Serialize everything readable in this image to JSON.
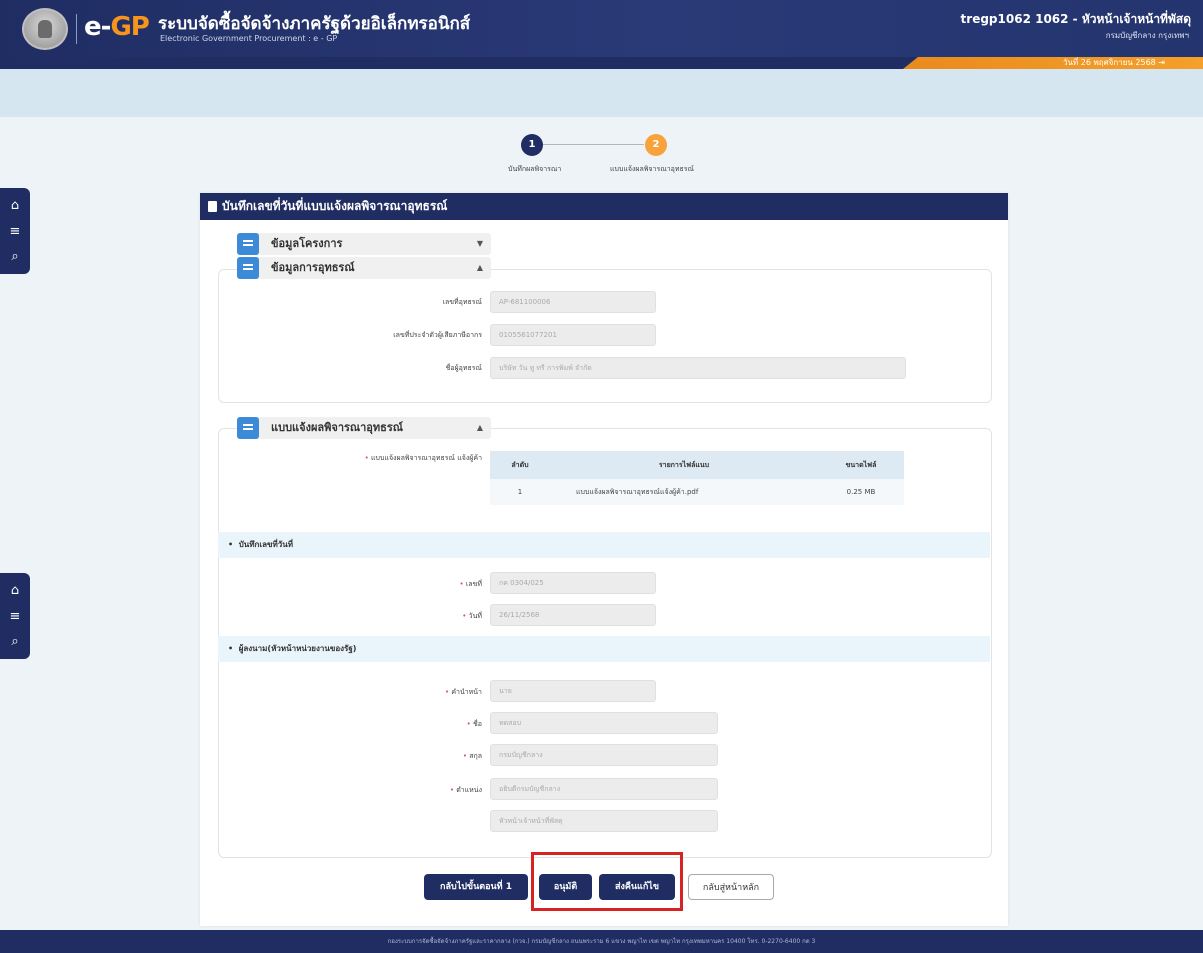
{
  "header": {
    "logo": "e-GP",
    "title": "ระบบจัดซื้อจัดจ้างภาครัฐด้วยอิเล็กทรอนิกส์",
    "subtitle": "Electronic Government Procurement : e - GP",
    "user": "tregp1062 1062 - หัวหน้าเจ้าหน้าที่พัสดุ",
    "department": "กรมบัญชีกลาง กรุงเทพฯ",
    "date": "วันที่ 26 พฤศจิกายน 2568"
  },
  "stepper": {
    "steps": [
      {
        "number": "1",
        "label": "บันทึกผลพิจารณา"
      },
      {
        "number": "2",
        "label": "แบบแจ้งผลพิจารณาอุทธรณ์"
      }
    ]
  },
  "card": {
    "title": "บันทึกเลขที่วันที่แบบแจ้งผลพิจารณาอุทธรณ์",
    "project_section": {
      "title": "ข้อมูลโครงการ"
    },
    "appeal_section": {
      "title": "ข้อมูลการอุทธรณ์",
      "fields": [
        {
          "label": "เลขที่อุทธรณ์",
          "value": "AP-681100006"
        },
        {
          "label": "เลขที่ประจำตัวผู้เสียภาษีอากร",
          "value": "0105561077201"
        },
        {
          "label": "ชื่อผู้อุทธรณ์",
          "value": "บริษัท วัน ทู ทรี การพิมพ์ จำกัด"
        }
      ]
    },
    "result_section": {
      "title": "แบบแจ้งผลพิจารณาอุทธรณ์",
      "file_label": "แบบแจ้งผลพิจารณาอุทธรณ์ แจ้งผู้ค้า",
      "table": {
        "headers": [
          "ลำดับ",
          "รายการไฟล์แนบ",
          "ขนาดไฟล์"
        ],
        "rows": [
          [
            "1",
            "แบบแจ้งผลพิจารณาอุทธรณ์แจ้งผู้ค้า.pdf",
            "0.25 MB"
          ]
        ]
      },
      "record_heading": "บันทึกเลขที่วันที่",
      "number_label": "เลขที่",
      "number_value": "กค 0304/025",
      "date_label": "วันที่",
      "date_value": "26/11/2568",
      "signer_heading": "ผู้ลงนาม(หัวหน้าหน่วยงานของรัฐ)",
      "prefix_label": "คำนำหน้า",
      "prefix_value": "นาย",
      "name_label": "ชื่อ",
      "name_value": "ทดสอบ",
      "surname_label": "สกุล",
      "surname_value": "กรมบัญชีกลาง",
      "position_label": "ตำแหน่ง",
      "position_value": "อธิบดีกรมบัญชีกลาง",
      "position_value2": "หัวหน้าเจ้าหน้าที่พัสดุ"
    },
    "buttons": {
      "back_step": "กลับไปขั้นตอนที่ 1",
      "approve": "อนุมัติ",
      "return": "ส่งคืนแก้ไข",
      "home": "กลับสู่หน้าหลัก"
    }
  },
  "footer": "กองระบบการจัดซื้อจัดจ้างภาครัฐและราคากลาง (กวจ.) กรมบัญชีกลาง ถนนพระราม 6 แขวง พญาไท เขต พญาไท กรุงเทพมหานคร 10400 โทร. 0-2270-6400 กด 3"
}
